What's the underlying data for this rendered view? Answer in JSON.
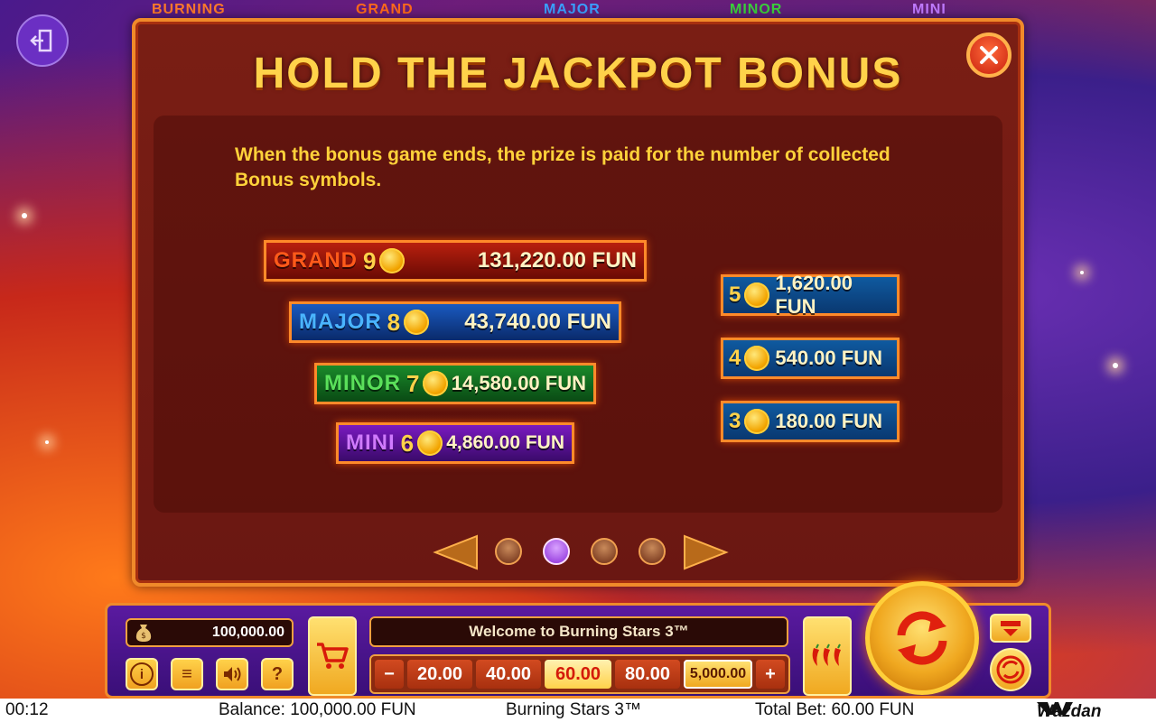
{
  "top_strip": {
    "labels": [
      "BURNING",
      "GRAND",
      "MAJOR",
      "MINOR",
      "MINI"
    ]
  },
  "panel": {
    "title": "HOLD THE JACKPOT BONUS",
    "description": "When the bonus game ends, the prize is paid for the number of collected Bonus symbols."
  },
  "jackpots": [
    {
      "name": "GRAND",
      "count": "9",
      "prize": "131,220.00 FUN",
      "color": "#e8401a"
    },
    {
      "name": "MAJOR",
      "count": "8",
      "prize": "43,740.00 FUN",
      "color": "#2a8ae6"
    },
    {
      "name": "MINOR",
      "count": "7",
      "prize": "14,580.00 FUN",
      "color": "#2ab82a"
    },
    {
      "name": "MINI",
      "count": "6",
      "prize": "4,860.00 FUN",
      "color": "#a03ae0"
    }
  ],
  "small_prizes": [
    {
      "count": "5",
      "prize": "1,620.00 FUN"
    },
    {
      "count": "4",
      "prize": "540.00 FUN"
    },
    {
      "count": "3",
      "prize": "180.00 FUN"
    }
  ],
  "pager": {
    "pages": 4,
    "active_index": 1
  },
  "controls": {
    "balance": "100,000.00",
    "message": "Welcome to Burning Stars 3™",
    "bet_minus": "−",
    "bet_plus": "+",
    "bets": [
      "20.00",
      "40.00",
      "60.00",
      "80.00",
      "5,000.00"
    ],
    "selected_bet": "60.00",
    "info_label": "i",
    "menu_label": "≡",
    "help_label": "?"
  },
  "status_bar": {
    "time": "00:12",
    "balance": "Balance: 100,000.00 FUN",
    "game": "Burning Stars 3™",
    "total_bet": "Total Bet: 60.00 FUN",
    "brand": "Wazdan"
  }
}
